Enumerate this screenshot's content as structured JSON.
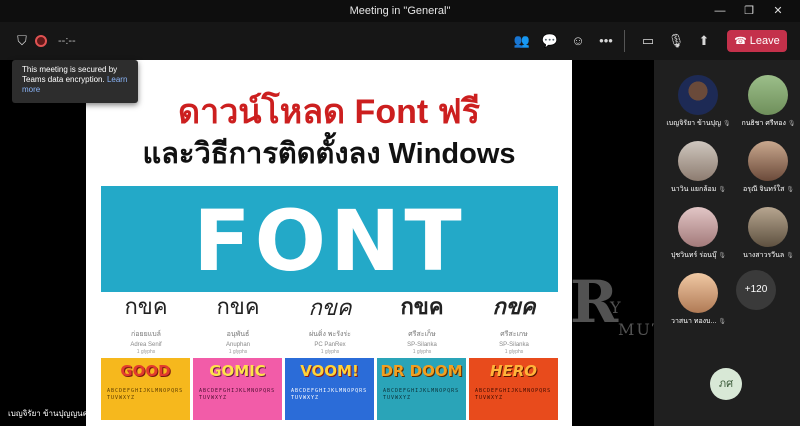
{
  "window": {
    "title": "Meeting in \"General\""
  },
  "toolbar": {
    "timer": "--:--",
    "leave_label": "Leave"
  },
  "tooltip": {
    "text": "This meeting is secured by Teams data encryption.",
    "link": "Learn more"
  },
  "slide": {
    "headline1": "ดาวน์โหลด Font ฟรี",
    "headline2": "และวิธีการติดตั้งลง Windows",
    "banner_word": "FONT",
    "samples": [
      {
        "glyph": "กขค",
        "th": "ก่อยยแบล์",
        "en": "Adrea Senif",
        "sub": "1 glyphs"
      },
      {
        "glyph": "กขค",
        "th": "อนุพันธ์",
        "en": "Anuphan",
        "sub": "1 glyphs"
      },
      {
        "glyph": "กขค",
        "th": "ผ่นดิ่ง พะรังร่ะ",
        "en": "PC PanRex",
        "sub": "1 glyphs"
      },
      {
        "glyph": "กขค",
        "th": "ศรีสะเก็ษ",
        "en": "SP-Silanka",
        "sub": "1 glyphs"
      },
      {
        "glyph": "กขค",
        "th": "ศรีสะเกษ",
        "en": "SP-Silanka",
        "sub": "1 glyphs"
      }
    ],
    "tiles": [
      {
        "name": "GOOD",
        "abc": "ABCDEFGHIJKLMNOPQRSTUVWXYZ"
      },
      {
        "name": "GOMIC",
        "abc": "ABCDEFGHIJKLMNOPQRSTUVWXYZ"
      },
      {
        "name": "VOOM!",
        "abc": "ABCDEFGHIJKLMNOPQRSTUVWXYZ"
      },
      {
        "name": "DR DOOM",
        "abc": "ABCDEFGHIJKLMNOPQRSTUVWXYZ"
      },
      {
        "name": "HERO",
        "abc": "ABCDEFGHIJKLMNOPQRSTUVWXYZ"
      }
    ]
  },
  "presenter_name": "เบญจิรัยา ข้านปุญญนคร",
  "watermark": {
    "r": "R",
    "y": "Y",
    "m": "MUTT"
  },
  "participants": [
    {
      "name": "เบญจิรัยา ข้านปุญ"
    },
    {
      "name": "กนธิชา ศรีทอง"
    },
    {
      "name": "นาวิน แยกล้อม"
    },
    {
      "name": "อรุณี จินทร์ใส"
    },
    {
      "name": "ปุชวินทร์ ร่อนบุ๊"
    },
    {
      "name": "นางสาวรวีนล"
    },
    {
      "name": "วาสนา ทองบ..."
    }
  ],
  "more_count": "+120",
  "self_initials": "ภศ",
  "colors": {
    "accent_red": "#cc1f1f",
    "banner_blue": "#23a9c8",
    "leave": "#c4314b"
  }
}
